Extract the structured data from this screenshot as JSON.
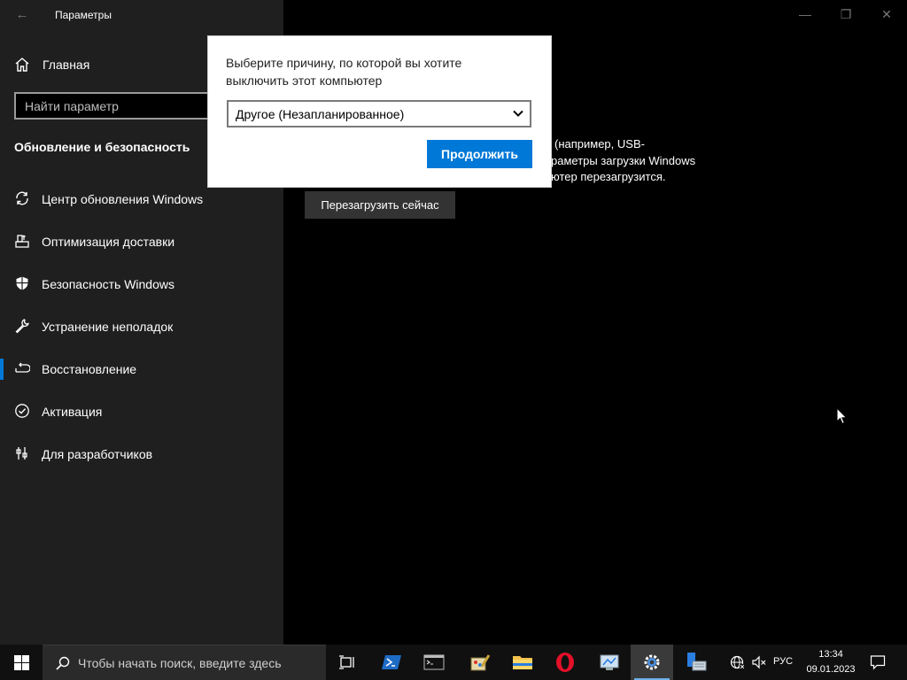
{
  "window": {
    "title": "Параметры",
    "controls": {
      "minimize": "—",
      "maximize": "❐",
      "close": "✕"
    }
  },
  "sidebar": {
    "home_label": "Главная",
    "search_placeholder": "Найти параметр",
    "section_title": "Обновление и безопасность",
    "items": [
      {
        "label": "Центр обновления Windows",
        "icon": "sync-icon"
      },
      {
        "label": "Оптимизация доставки",
        "icon": "delivery-optimization-icon"
      },
      {
        "label": "Безопасность Windows",
        "icon": "shield-icon"
      },
      {
        "label": "Устранение неполадок",
        "icon": "wrench-icon"
      },
      {
        "label": "Восстановление",
        "icon": "recovery-icon",
        "selected": true
      },
      {
        "label": "Активация",
        "icon": "checkmark-circle-icon"
      },
      {
        "label": "Для разработчиков",
        "icon": "developer-icon"
      }
    ]
  },
  "main": {
    "partial_lines": [
      "(например, USB-",
      "раметры загрузки Windows",
      "ютер перезагрузится."
    ],
    "restart_button": "Перезагрузить сейчас"
  },
  "dialog": {
    "prompt": "Выберите причину, по которой вы хотите выключить этот компьютер",
    "selected_reason": "Другое (Незапланированное)",
    "continue_button": "Продолжить"
  },
  "taskbar": {
    "search_placeholder": "Чтобы начать поиск, введите здесь",
    "language": "РУС",
    "time": "13:34",
    "date": "09.01.2023",
    "apps": [
      "task-view-icon",
      "powershell-icon",
      "command-prompt-icon",
      "paint-icon",
      "file-explorer-icon",
      "opera-icon",
      "control-panel-icon",
      "settings-gear-icon",
      "server-manager-icon"
    ]
  },
  "colors": {
    "accent": "#0078d7",
    "sidebar_bg": "#1f1f1f",
    "content_bg": "#000000",
    "taskbar_bg": "#101010"
  }
}
